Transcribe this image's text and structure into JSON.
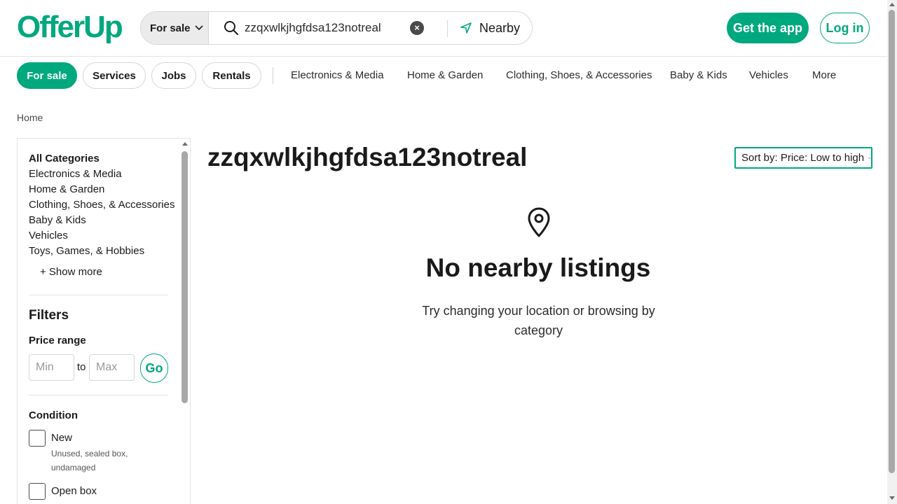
{
  "header": {
    "logo": "OfferUp",
    "search": {
      "type_label": "For sale",
      "query": "zzqxwlkjhgfdsa123notreal",
      "clear_icon": "close-icon",
      "location_label": "Nearby"
    },
    "get_app_label": "Get the app",
    "login_label": "Log in"
  },
  "nav": {
    "pills": [
      {
        "label": "For sale",
        "active": true
      },
      {
        "label": "Services",
        "active": false
      },
      {
        "label": "Jobs",
        "active": false
      },
      {
        "label": "Rentals",
        "active": false
      }
    ],
    "categories": [
      "Electronics & Media",
      "Home & Garden",
      "Clothing, Shoes, & Accessories",
      "Baby & Kids",
      "Vehicles",
      "More"
    ]
  },
  "breadcrumb": "Home",
  "sidebar": {
    "categories": [
      "All Categories",
      "Electronics & Media",
      "Home & Garden",
      "Clothing, Shoes, & Accessories",
      "Baby & Kids",
      "Vehicles",
      "Toys, Games, & Hobbies"
    ],
    "show_more": "+ Show more",
    "filters_title": "Filters",
    "price_range_title": "Price range",
    "min_placeholder": "Min",
    "max_placeholder": "Max",
    "to_label": "to",
    "go_label": "Go",
    "condition_title": "Condition",
    "conditions": [
      {
        "label": "New",
        "description": "Unused, sealed box, undamaged"
      },
      {
        "label": "Open box",
        "description": ""
      }
    ]
  },
  "main": {
    "title": "zzqxwlkjhgfdsa123notreal",
    "sort_label": "Sort by: Price: Low to high",
    "empty_title": "No nearby listings",
    "empty_subtitle": "Try changing your location or browsing by category"
  },
  "colors": {
    "brand": "#00a87e",
    "text": "#1a1a1a",
    "border": "#d6d6d6"
  }
}
